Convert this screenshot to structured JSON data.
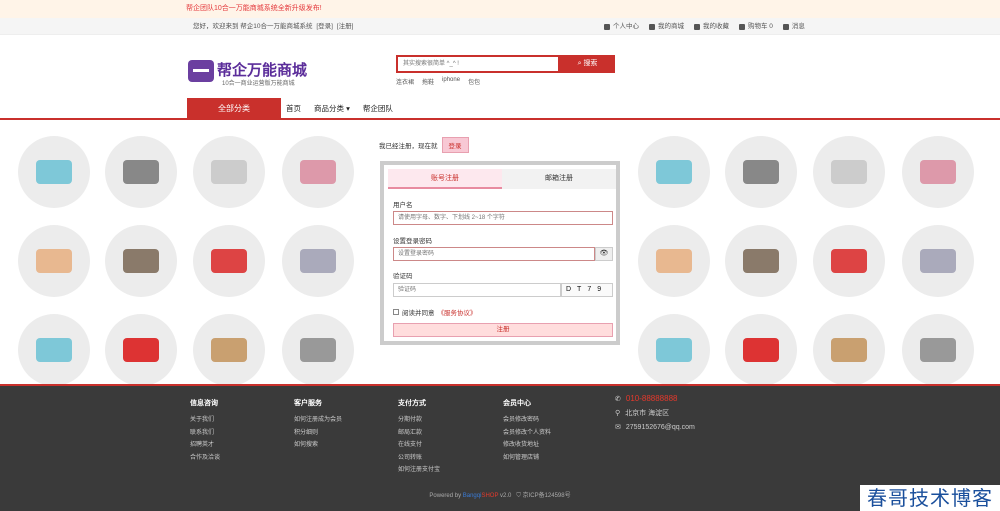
{
  "announcement": "帮企团队10合一万能商城系统全新升级发布!",
  "topbar": {
    "welcome": "您好，欢迎来到 帮企10合一万能商城系统",
    "login": "[登录]",
    "register": "[注册]",
    "links": [
      "个人中心",
      "我的商城",
      "我的收藏",
      "购物车 0",
      "消息"
    ]
  },
  "logo": {
    "name": "帮企万能商城",
    "slogan": "10合一商业运营版万能商城"
  },
  "search": {
    "placeholder": "其实搜索很简单 ^_^ !",
    "button": "搜索",
    "hotwords": [
      "连衣裙",
      "拖鞋",
      "iphone",
      "包包"
    ]
  },
  "nav": {
    "all_categories": "全部分类",
    "links": [
      "首页",
      "商品分类 ▾",
      "帮企团队"
    ]
  },
  "already": {
    "text": "我已经注册，现在就",
    "login": "登录"
  },
  "form": {
    "tabs": [
      "账号注册",
      "邮箱注册"
    ],
    "username_label": "用户名",
    "username_placeholder": "请使用字母、数字、下划线 2~18 个字符",
    "password_label": "设置登录密码",
    "password_placeholder": "设置登录密码",
    "captcha_label": "验证码",
    "captcha_placeholder": "验证码",
    "captcha_text": "DT79",
    "agree_text": "阅读并同意",
    "agree_link": "《服务协议》",
    "submit": "注册"
  },
  "footer": {
    "columns": [
      {
        "title": "信息咨询",
        "links": [
          "关于我们",
          "联系我们",
          "招聘英才",
          "合作及洽谈"
        ]
      },
      {
        "title": "客户服务",
        "links": [
          "如何注册成为会员",
          "积分细则",
          "如何搜索"
        ]
      },
      {
        "title": "支付方式",
        "links": [
          "分期付款",
          "邮局汇款",
          "在线支付",
          "公司转账",
          "如何注册支付宝"
        ]
      },
      {
        "title": "会员中心",
        "links": [
          "会员修改密码",
          "会员修改个人资料",
          "修改收货地址",
          "如何管理店铺"
        ]
      }
    ],
    "phone": "010-88888888",
    "address": "北京市 海淀区",
    "email": "2759152676@qq.com",
    "powered_prefix": "Powered by ",
    "powered_brand": "Bangqi",
    "powered_brand2": "SHOP",
    "powered_version": " v2.0",
    "icp": "京ICP备124598号"
  },
  "watermark": "春哥技术博客",
  "colors": {
    "accent": "#c9302c",
    "brand": "#5b2d9a",
    "footer_bg": "#3a3a3a"
  }
}
